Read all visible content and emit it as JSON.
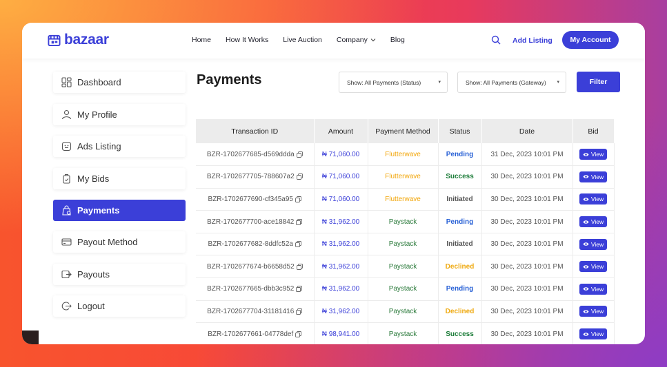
{
  "brand": {
    "name": "bazaar",
    "color": "#3b3fd8"
  },
  "nav": {
    "items": [
      {
        "label": "Home",
        "icon": null
      },
      {
        "label": "How It Works",
        "icon": null
      },
      {
        "label": "Live Auction",
        "icon": null
      },
      {
        "label": "Company",
        "icon": "chevron-down-icon"
      },
      {
        "label": "Blog",
        "icon": null
      }
    ],
    "search_icon": "search-icon",
    "add_listing": "Add Listing",
    "account_button": "My Account"
  },
  "sidebar": {
    "items": [
      {
        "label": "Dashboard",
        "icon": "dashboard-icon",
        "active": false
      },
      {
        "label": "My Profile",
        "icon": "user-icon",
        "active": false
      },
      {
        "label": "Ads Listing",
        "icon": "ads-icon",
        "active": false
      },
      {
        "label": "My Bids",
        "icon": "bids-icon",
        "active": false
      },
      {
        "label": "Payments",
        "icon": "payments-icon",
        "active": true
      },
      {
        "label": "Payout Method",
        "icon": "card-icon",
        "active": false
      },
      {
        "label": "Payouts",
        "icon": "payouts-icon",
        "active": false
      },
      {
        "label": "Logout",
        "icon": "logout-icon",
        "active": false
      }
    ]
  },
  "main": {
    "title": "Payments",
    "status_select": "Show: All Payments (Status)",
    "gateway_select": "Show: All Payments (Gateway)",
    "filter_button": "Filter"
  },
  "table": {
    "headers": [
      "Transaction ID",
      "Amount",
      "Payment Method",
      "Status",
      "Date",
      "Bid"
    ],
    "view_label": "View",
    "rows": [
      {
        "id": "BZR-1702677685-d569ddda",
        "amount": "₦ 71,060.00",
        "method": "Flutterwave",
        "status": "Pending",
        "date": "31 Dec, 2023 10:01 PM"
      },
      {
        "id": "BZR-1702677705-788607a2",
        "amount": "₦ 71,060.00",
        "method": "Flutterwave",
        "status": "Success",
        "date": "30 Dec, 2023 10:01 PM"
      },
      {
        "id": "BZR-1702677690-cf345a95",
        "amount": "₦ 71,060.00",
        "method": "Flutterwave",
        "status": "Initiated",
        "date": "30 Dec, 2023 10:01 PM"
      },
      {
        "id": "BZR-1702677700-ace18842",
        "amount": "₦ 31,962.00",
        "method": "Paystack",
        "status": "Pending",
        "date": "30 Dec, 2023 10:01 PM"
      },
      {
        "id": "BZR-1702677682-8ddfc52a",
        "amount": "₦ 31,962.00",
        "method": "Paystack",
        "status": "Initiated",
        "date": "30 Dec, 2023 10:01 PM"
      },
      {
        "id": "BZR-1702677674-b6658d52",
        "amount": "₦ 31,962.00",
        "method": "Paystack",
        "status": "Declined",
        "date": "30 Dec, 2023 10:01 PM"
      },
      {
        "id": "BZR-1702677665-dbb3c952",
        "amount": "₦ 31,962.00",
        "method": "Paystack",
        "status": "Pending",
        "date": "30 Dec, 2023 10:01 PM"
      },
      {
        "id": "BZR-1702677704-31181416",
        "amount": "₦ 31,962.00",
        "method": "Paystack",
        "status": "Declined",
        "date": "30 Dec, 2023 10:01 PM"
      },
      {
        "id": "BZR-1702677661-04778def",
        "amount": "₦ 98,941.00",
        "method": "Paystack",
        "status": "Success",
        "date": "30 Dec, 2023 10:01 PM"
      }
    ]
  }
}
